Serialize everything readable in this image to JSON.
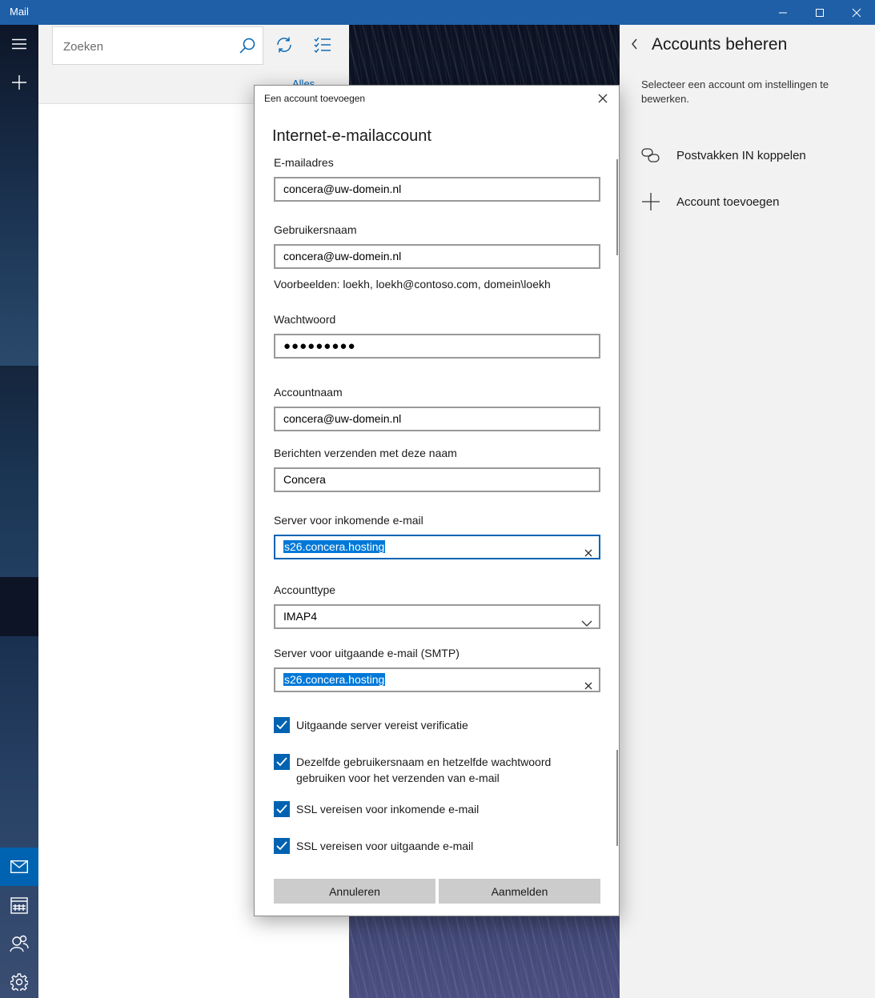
{
  "window": {
    "title": "Mail"
  },
  "rail": {
    "icons": [
      "menu-icon",
      "plus-icon",
      "mail-icon",
      "calendar-icon",
      "people-icon",
      "gear-icon"
    ]
  },
  "list": {
    "search_placeholder": "Zoeken",
    "filter_label": "Alles"
  },
  "settings": {
    "title": "Accounts beheren",
    "description": "Selecteer een account om instellingen te bewerken.",
    "items": [
      {
        "label": "Postvakken IN koppelen",
        "icon": "link-icon"
      },
      {
        "label": "Account toevoegen",
        "icon": "plus-icon"
      }
    ]
  },
  "dialog": {
    "caption": "Een account toevoegen",
    "heading": "Internet-e-mailaccount",
    "email": {
      "label": "E-mailadres",
      "value": "concera@uw-domein.nl"
    },
    "username": {
      "label": "Gebruikersnaam",
      "value": "concera@uw-domein.nl",
      "hint": "Voorbeelden: loekh, loekh@contoso.com, domein\\loekh"
    },
    "password": {
      "label": "Wachtwoord",
      "value": "●●●●●●●●●"
    },
    "account_name": {
      "label": "Accountnaam",
      "value": "concera@uw-domein.nl"
    },
    "sender_name": {
      "label": "Berichten verzenden met deze naam",
      "value": "Concera"
    },
    "incoming": {
      "label": "Server voor inkomende e-mail",
      "value": "s26.concera.hosting"
    },
    "account_type": {
      "label": "Accounttype",
      "value": "IMAP4"
    },
    "outgoing": {
      "label": "Server voor uitgaande e-mail (SMTP)",
      "value": "s26.concera.hosting"
    },
    "checks": [
      {
        "label": "Uitgaande server vereist verificatie",
        "checked": true
      },
      {
        "label": "Dezelfde gebruikersnaam en hetzelfde wachtwoord gebruiken voor het verzenden van e-mail",
        "checked": true
      },
      {
        "label": "SSL vereisen voor inkomende e-mail",
        "checked": true
      },
      {
        "label": "SSL vereisen voor uitgaande e-mail",
        "checked": true
      }
    ],
    "cancel_label": "Annuleren",
    "signin_label": "Aanmelden"
  },
  "colors": {
    "accent": "#0063b1",
    "titlebar": "#1f5fa8",
    "selection": "#0078d7"
  }
}
